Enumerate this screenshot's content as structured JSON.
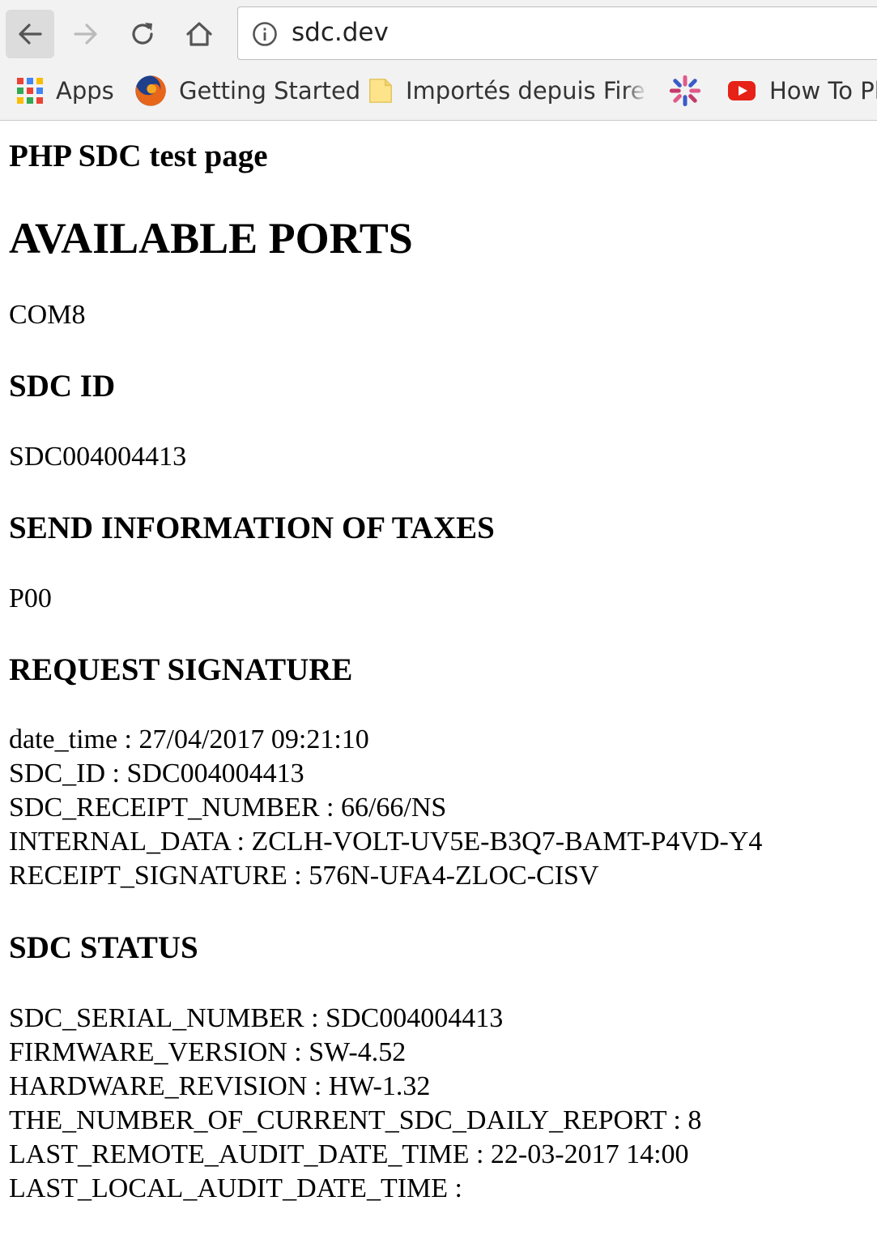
{
  "browser": {
    "url": "sdc.dev",
    "bookmarks": [
      {
        "label": "Apps",
        "icon": "apps-grid-icon"
      },
      {
        "label": "Getting Started",
        "icon": "firefox-icon"
      },
      {
        "label": "Importés depuis Firefox",
        "icon": "folder-icon"
      },
      {
        "label": "",
        "icon": "pinwheel-icon"
      },
      {
        "label": "How To Pl",
        "icon": "youtube-icon"
      }
    ]
  },
  "page": {
    "title": "PHP SDC test page",
    "available_ports": {
      "heading": "AVAILABLE PORTS",
      "value": "COM8"
    },
    "sdc_id": {
      "heading": "SDC ID",
      "value": "SDC004004413"
    },
    "send_taxes": {
      "heading": "SEND INFORMATION OF TAXES",
      "value": "P00"
    },
    "request_signature": {
      "heading": "REQUEST SIGNATURE",
      "lines": [
        "date_time : 27/04/2017 09:21:10",
        "SDC_ID : SDC004004413",
        "SDC_RECEIPT_NUMBER : 66/66/NS",
        "INTERNAL_DATA : ZCLH-VOLT-UV5E-B3Q7-BAMT-P4VD-Y4",
        "RECEIPT_SIGNATURE : 576N-UFA4-ZLOC-CISV"
      ]
    },
    "sdc_status": {
      "heading": "SDC STATUS",
      "lines": [
        "SDC_SERIAL_NUMBER : SDC004004413",
        "FIRMWARE_VERSION : SW-4.52",
        "HARDWARE_REVISION : HW-1.32",
        "THE_NUMBER_OF_CURRENT_SDC_DAILY_REPORT : 8",
        "LAST_REMOTE_AUDIT_DATE_TIME : 22-03-2017 14:00",
        "LAST_LOCAL_AUDIT_DATE_TIME :"
      ]
    }
  }
}
